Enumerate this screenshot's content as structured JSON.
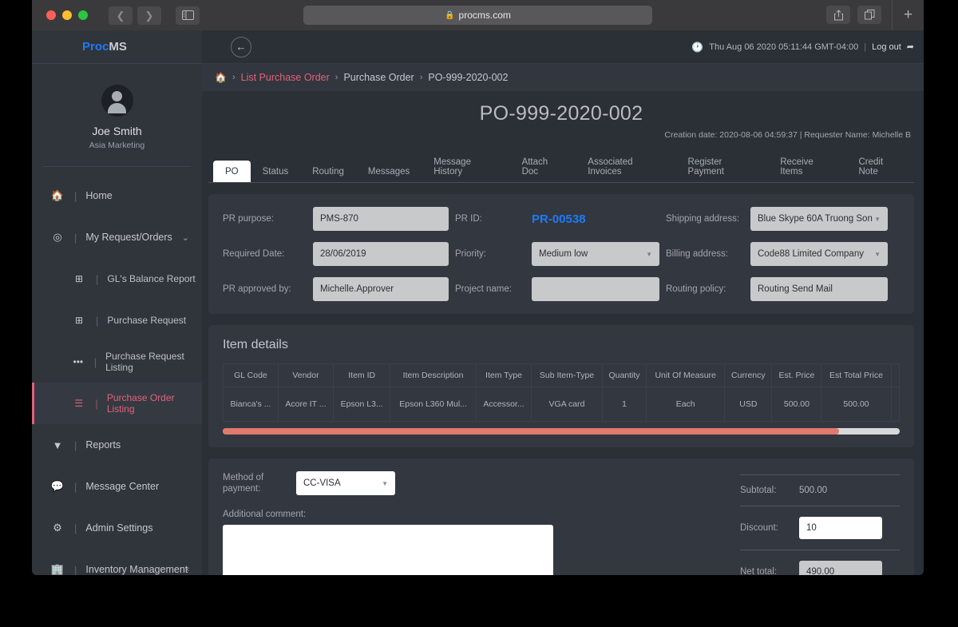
{
  "browser": {
    "url": "procms.com",
    "lock_icon": "lock-icon",
    "back_icon": "chevron-left-icon",
    "forward_icon": "chevron-right-icon",
    "sidebar_icon": "sidebar-toggle-icon",
    "share_icon": "share-icon",
    "tabs_icon": "show-tabs-icon",
    "new_tab_icon": "plus-icon"
  },
  "brand": {
    "part1": "Proc",
    "part2": "MS"
  },
  "topbar": {
    "back_icon": "arrow-left-icon",
    "clock_icon": "clock-icon",
    "datetime": "Thu Aug 06 2020 05:11:44 GMT-04:00",
    "pipe": "|",
    "logout_label": "Log out",
    "logout_icon": "logout-icon"
  },
  "sidebar": {
    "profile": {
      "name": "Joe Smith",
      "role": "Asia Marketing"
    },
    "items": [
      {
        "label": "Home",
        "icon": "home-icon",
        "level": "top",
        "active": false
      },
      {
        "label": "My Request/Orders",
        "icon": "target-icon",
        "level": "top",
        "active": false,
        "chevron": "chevron-down-icon"
      },
      {
        "label": "GL's Balance Report",
        "icon": "plus-square-icon",
        "level": "sub",
        "active": false
      },
      {
        "label": "Purchase Request",
        "icon": "plus-square-icon",
        "level": "sub",
        "active": false
      },
      {
        "label": "Purchase Request Listing",
        "icon": "ellipsis-icon",
        "level": "sub",
        "active": false
      },
      {
        "label": "Purchase Order Listing",
        "icon": "menu-lines-icon",
        "level": "sub",
        "active": true
      },
      {
        "label": "Reports",
        "icon": "funnel-icon",
        "level": "top",
        "active": false
      },
      {
        "label": "Message Center",
        "icon": "chat-icon",
        "level": "top",
        "active": false
      },
      {
        "label": "Admin Settings",
        "icon": "gears-icon",
        "level": "top",
        "active": false
      },
      {
        "label": "Inventory Management",
        "icon": "building-icon",
        "level": "top",
        "active": false,
        "chevron": "chevron-left-icon"
      }
    ]
  },
  "breadcrumb": {
    "home_icon": "home-icon",
    "sep": "›",
    "item1": "List Purchase Order",
    "item2": "Purchase Order",
    "item3": "PO-999-2020-002"
  },
  "page": {
    "title": "PO-999-2020-002",
    "meta": "Creation date: 2020-08-06 04:59:37 | Requester Name: Michelle B"
  },
  "tabs": [
    {
      "label": "PO",
      "active": true
    },
    {
      "label": "Status",
      "active": false
    },
    {
      "label": "Routing",
      "active": false
    },
    {
      "label": "Messages",
      "active": false
    },
    {
      "label": "Message History",
      "active": false
    },
    {
      "label": "Attach Doc",
      "active": false
    },
    {
      "label": "Associated Invoices",
      "active": false
    },
    {
      "label": "Register Payment",
      "active": false
    },
    {
      "label": "Receive Items",
      "active": false
    },
    {
      "label": "Credit Note",
      "active": false
    }
  ],
  "form": {
    "pr_purpose_label": "PR purpose:",
    "pr_purpose_value": "PMS-870",
    "required_date_label": "Required Date:",
    "required_date_value": "28/06/2019",
    "pr_approved_label": "PR approved by:",
    "pr_approved_value": "Michelle.Approver",
    "pr_id_label": "PR ID:",
    "pr_id_value": "PR-00538",
    "priority_label": "Priority:",
    "priority_value": "Medium low",
    "project_name_label": "Project name:",
    "project_name_value": "",
    "shipping_label": "Shipping address:",
    "shipping_value": "Blue Skype 60A Truong Son",
    "billing_label": "Billing address:",
    "billing_value": "Code88 Limited Company",
    "routing_label": "Routing policy:",
    "routing_value": "Routing Send Mail",
    "caret_icon": "caret-down-icon"
  },
  "items": {
    "heading": "Item details",
    "columns": [
      "GL Code",
      "Vendor",
      "Item ID",
      "Item Description",
      "Item Type",
      "Sub Item-Type",
      "Quantity",
      "Unit Of Measure",
      "Currency",
      "Est. Price",
      "Est Total Price",
      ""
    ],
    "rows": [
      [
        "Bianca's ...",
        "Acore IT ...",
        "Epson L3...",
        "Epson L360 Mul...",
        "Accessor...",
        "VGA card",
        "1",
        "Each",
        "USD",
        "500.00",
        "500.00",
        ""
      ]
    ],
    "scroll_percent": 91
  },
  "payment": {
    "method_label": "Method of payment:",
    "method_value": "CC-VISA",
    "caret_icon": "caret-down-icon",
    "comment_label": "Additional comment:",
    "comment_value": "",
    "subtotal_label": "Subtotal:",
    "subtotal_value": "500.00",
    "discount_label": "Discount:",
    "discount_value": "10",
    "nettotal_label": "Net total:",
    "nettotal_value": "490.00"
  },
  "colors": {
    "accent_blue": "#1e7bf5",
    "accent_pink": "#e2617a",
    "scroll_red": "#e2685a",
    "panel_bg": "#333740",
    "app_bg": "#2b2f36",
    "sidebar_bg": "#30343b"
  }
}
